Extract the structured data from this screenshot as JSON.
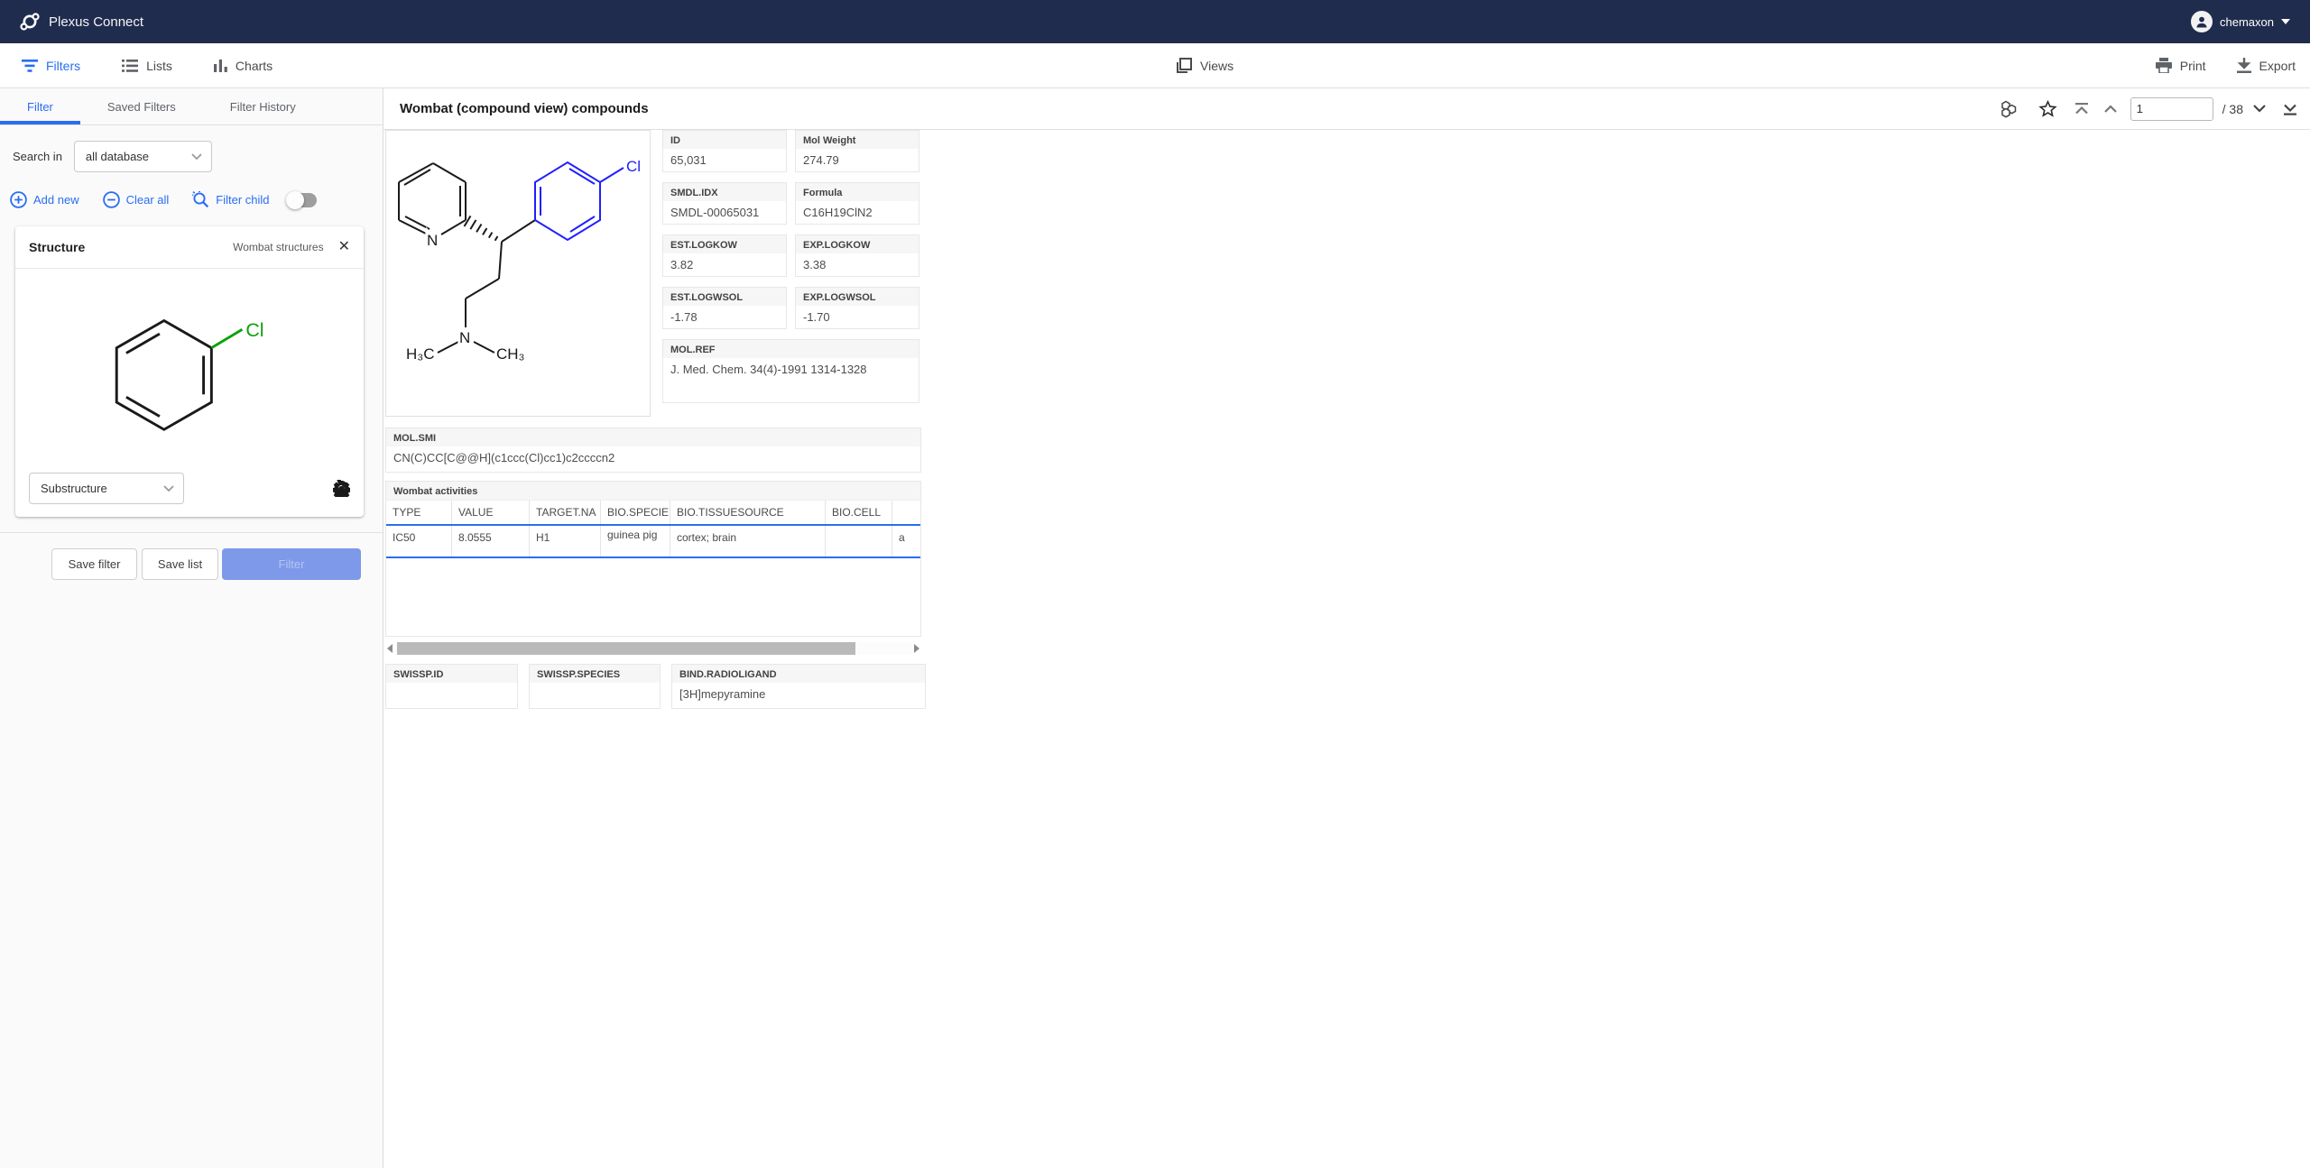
{
  "header": {
    "app_title": "Plexus Connect",
    "user_name": "chemaxon"
  },
  "toolbar": {
    "filters_label": "Filters",
    "lists_label": "Lists",
    "charts_label": "Charts",
    "views_label": "Views",
    "print_label": "Print",
    "export_label": "Export"
  },
  "sidebar": {
    "tabs": {
      "filter": "Filter",
      "saved_filters": "Saved Filters",
      "filter_history": "Filter History"
    },
    "search_in": {
      "label": "Search in",
      "value": "all database"
    },
    "actions": {
      "add_new": "Add new",
      "clear_all": "Clear all",
      "filter_child": "Filter child"
    },
    "structure_card": {
      "title": "Structure",
      "source_label": "Wombat structures",
      "match_mode": "Substructure",
      "atom_label_cl": "Cl"
    },
    "footer_buttons": {
      "save_filter": "Save filter",
      "save_list": "Save list",
      "filter": "Filter"
    }
  },
  "main": {
    "title": "Wombat (compound view) compounds",
    "pager": {
      "value": "1",
      "total_label": "/ 38"
    },
    "molecule_labels": {
      "pyridine_n": "N",
      "chlorine": "Cl",
      "amine_n": "N",
      "methyl_left": "H₃C",
      "methyl_right": "CH₃"
    },
    "fields": {
      "id": {
        "label": "ID",
        "value": "65,031"
      },
      "mol_weight": {
        "label": "Mol Weight",
        "value": "274.79"
      },
      "smdl_idx": {
        "label": "SMDL.IDX",
        "value": "SMDL-00065031"
      },
      "formula": {
        "label": "Formula",
        "value": "C16H19ClN2"
      },
      "est_logkow": {
        "label": "EST.LOGKOW",
        "value": "3.82"
      },
      "exp_logkow": {
        "label": "EXP.LOGKOW",
        "value": "3.38"
      },
      "est_logwsol": {
        "label": "EST.LOGWSOL",
        "value": "-1.78"
      },
      "exp_logwsol": {
        "label": "EXP.LOGWSOL",
        "value": "-1.70"
      },
      "mol_ref": {
        "label": "MOL.REF",
        "value": "J. Med. Chem. 34(4)-1991 1314-1328"
      },
      "mol_smi": {
        "label": "MOL.SMI",
        "value": "CN(C)CC[C@@H](c1ccc(Cl)cc1)c2ccccn2"
      },
      "swissp_id": {
        "label": "SWISSP.ID",
        "value": ""
      },
      "swissp_species": {
        "label": "SWISSP.SPECIES",
        "value": ""
      },
      "bind_radioligand": {
        "label": "BIND.RADIOLIGAND",
        "value": "[3H]mepyramine"
      }
    },
    "activities": {
      "title": "Wombat activities",
      "columns": [
        "TYPE",
        "VALUE",
        "TARGET.NA",
        "BIO.SPECIE",
        "BIO.TISSUESOURCE",
        "BIO.CELL"
      ],
      "row": {
        "type": "IC50",
        "value": "8.0555",
        "target": "H1",
        "species": "guinea pig",
        "tissue": "cortex; brain",
        "cell": "",
        "clipped": "a"
      }
    }
  }
}
